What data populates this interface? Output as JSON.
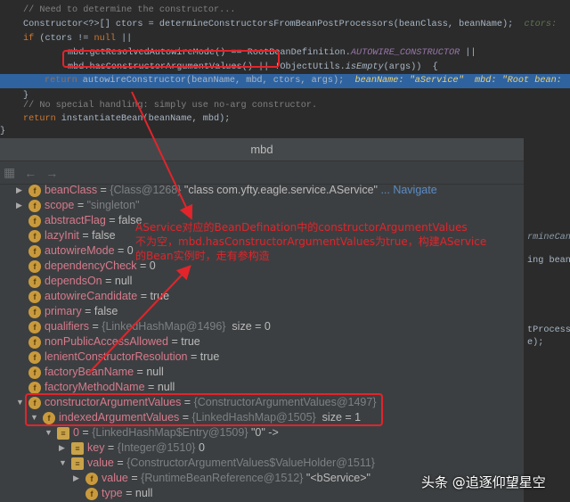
{
  "code": {
    "line1": "// Need to determine the constructor...",
    "line2a": "Constructor<?>[] ctors = determineConstructorsFromBeanPostProcessors(beanClass, beanName);",
    "line2b": "ctors:",
    "line3a": "if",
    "line3b": " (ctors != ",
    "line3c": "null",
    "line3d": " ||",
    "line4a": "mbd.getResolvedAutowireMode() == RootBeanDefinition.",
    "line4b": "AUTOWIRE_CONSTRUCTOR",
    "line4c": " ||",
    "line5a": "mbd.hasConstructorArgumentValues() ||",
    "line5b": " !ObjectUtils.",
    "line5c": "isEmpty",
    "line5d": "(args))  {",
    "line6a": "return",
    "line6b": " autowireConstructor(beanName, mbd, ctors, args);",
    "line6c": "beanName: \"aService\"  mbd: \"Root bean:",
    "line7": "}",
    "line9": "// No special handling: simply use no-arg constructor.",
    "line10a": "return",
    "line10b": " instantiateBean(beanName, mbd);",
    "line11": "}"
  },
  "right_partial": [
    "rmineCand",
    "ing beanN",
    "tProcesso",
    "e);"
  ],
  "popup": {
    "title": "mbd",
    "rows": [
      {
        "name": "beanClass",
        "eq": " = ",
        "ref": "{Class@1268}",
        "val": " \"class com.yfty.eagle.service.AService\"",
        "link": " ... Navigate"
      },
      {
        "name": "scope",
        "eq": " = ",
        "ref": "\"singleton\"",
        "val": ""
      },
      {
        "name": "abstractFlag",
        "eq": " = ",
        "val": "false"
      },
      {
        "name": "lazyInit",
        "eq": " = ",
        "val": "false"
      },
      {
        "name": "autowireMode",
        "eq": " = ",
        "val": "0"
      },
      {
        "name": "dependencyCheck",
        "eq": " = ",
        "val": "0"
      },
      {
        "name": "dependsOn",
        "eq": " = ",
        "val": "null"
      },
      {
        "name": "autowireCandidate",
        "eq": " = ",
        "val": "true"
      },
      {
        "name": "primary",
        "eq": " = ",
        "val": "false"
      },
      {
        "name": "qualifiers",
        "eq": " = ",
        "ref": "{LinkedHashMap@1496}",
        "val": "  size = 0"
      },
      {
        "name": "nonPublicAccessAllowed",
        "eq": " = ",
        "val": "true"
      },
      {
        "name": "lenientConstructorResolution",
        "eq": " = ",
        "val": "true"
      },
      {
        "name": "factoryBeanName",
        "eq": " = ",
        "val": "null"
      },
      {
        "name": "factoryMethodName",
        "eq": " = ",
        "val": "null"
      },
      {
        "name": "constructorArgumentValues",
        "eq": " = ",
        "ref": "{ConstructorArgumentValues@1497}",
        "val": ""
      },
      {
        "name": "indexedArgumentValues",
        "eq": " = ",
        "ref": "{LinkedHashMap@1505}",
        "val": "  size = 1"
      },
      {
        "name": "0",
        "eq": " = ",
        "ref": "{LinkedHashMap$Entry@1509}",
        "val": " \"0\" ->"
      },
      {
        "name": "key",
        "eq": " = ",
        "ref": "{Integer@1510}",
        "val": " 0"
      },
      {
        "name": "value",
        "eq": " = ",
        "ref": "{ConstructorArgumentValues$ValueHolder@1511}",
        "val": ""
      },
      {
        "name": "value",
        "eq": " = ",
        "ref": "{RuntimeBeanReference@1512}",
        "val": " \"<bService>\""
      },
      {
        "name": "type",
        "eq": " = ",
        "val": "null"
      }
    ]
  },
  "annotation": [
    "AService对应的BeanDefination中的constructorArgumentValues",
    "不为空，mbd.hasConstructorArgumentValues为true，构建AService",
    "的Bean实例时，走有参构造"
  ],
  "watermark": "头条 @追逐仰望星空"
}
